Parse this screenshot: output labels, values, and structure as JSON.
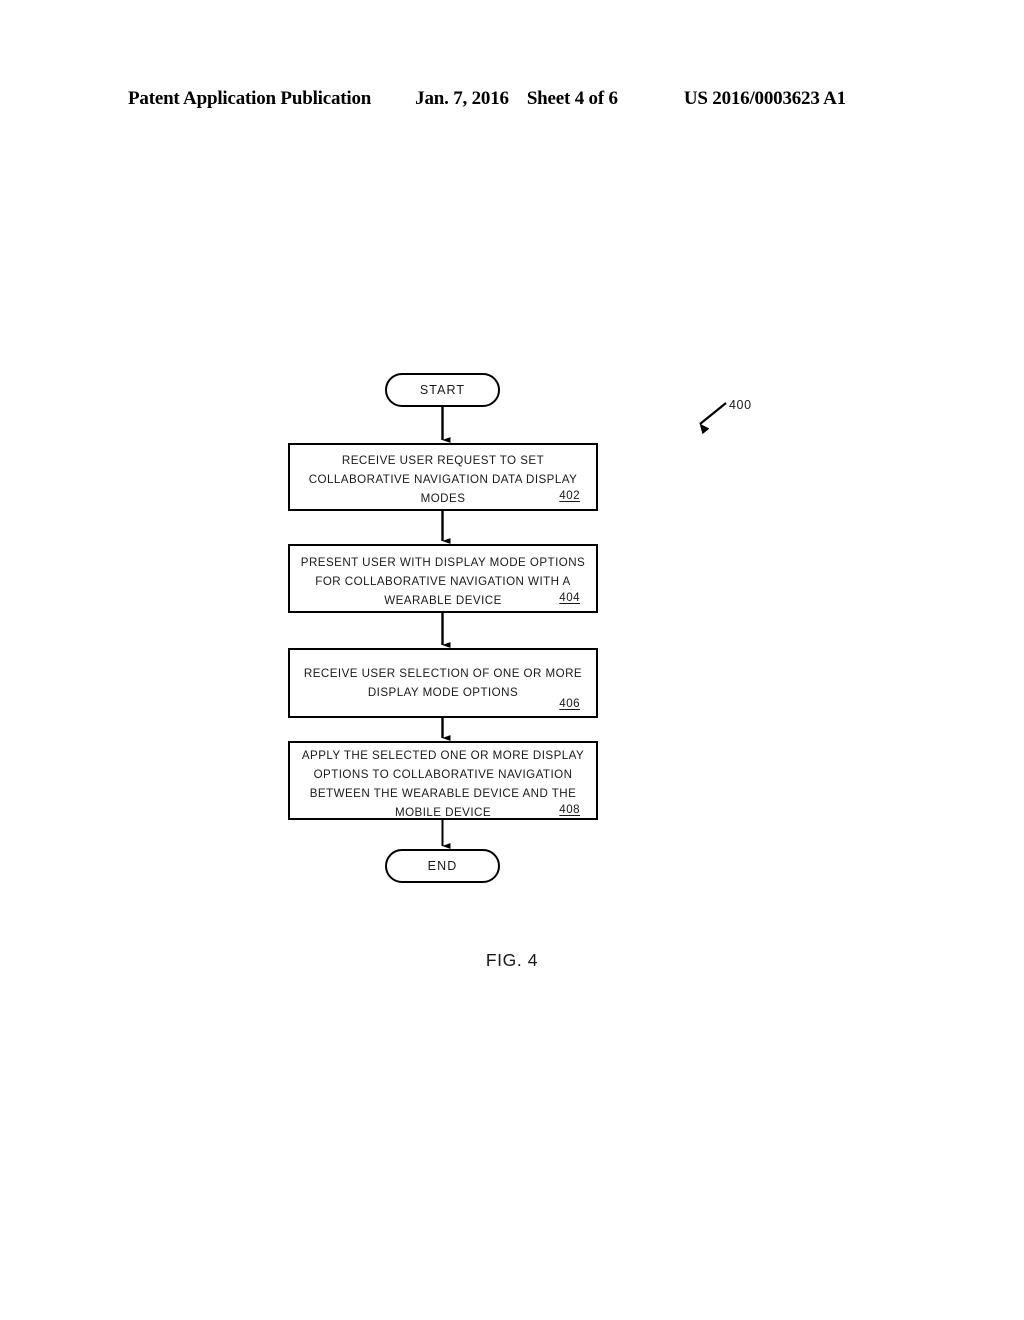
{
  "header": {
    "publication": "Patent Application Publication",
    "date": "Jan. 7, 2016",
    "sheet": "Sheet 4 of 6",
    "doc_number": "US 2016/0003623 A1"
  },
  "figure": {
    "caption": "FIG. 4",
    "reference_label": "400",
    "start_label": "START",
    "end_label": "END",
    "steps": [
      {
        "ref": "402",
        "lines": [
          "RECEIVE USER REQUEST TO SET",
          "COLLABORATIVE NAVIGATION DATA DISPLAY",
          "MODES"
        ]
      },
      {
        "ref": "404",
        "lines": [
          "PRESENT USER WITH DISPLAY MODE OPTIONS",
          "FOR COLLABORATIVE NAVIGATION WITH A",
          "WEARABLE DEVICE"
        ]
      },
      {
        "ref": "406",
        "lines": [
          "RECEIVE USER SELECTION OF ONE OR MORE",
          "DISPLAY MODE OPTIONS"
        ]
      },
      {
        "ref": "408",
        "lines": [
          "APPLY THE SELECTED ONE OR MORE DISPLAY",
          "OPTIONS TO COLLABORATIVE NAVIGATION",
          "BETWEEN THE WEARABLE DEVICE AND THE",
          "MOBILE DEVICE"
        ]
      }
    ]
  },
  "colors": {
    "ink": "#000000",
    "text": "#1a1a1a",
    "background": "#ffffff"
  }
}
